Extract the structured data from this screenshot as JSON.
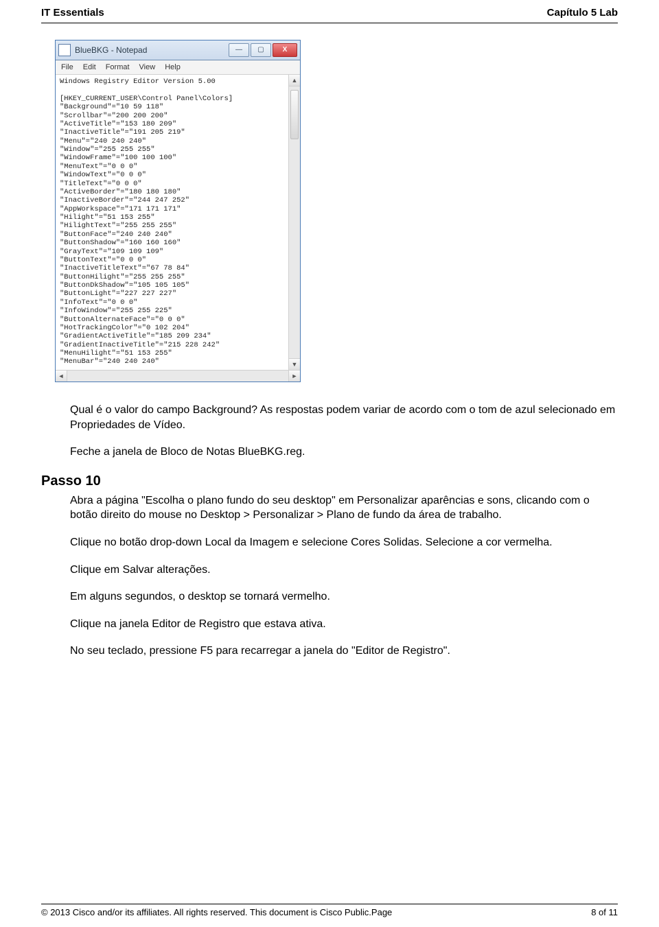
{
  "header": {
    "left": "IT Essentials",
    "right": "Capítulo 5 Lab"
  },
  "notepad": {
    "title": "BlueBKG - Notepad",
    "menu": [
      "File",
      "Edit",
      "Format",
      "View",
      "Help"
    ],
    "content": "Windows Registry Editor Version 5.00\n\n[HKEY_CURRENT_USER\\Control Panel\\Colors]\n\"Background\"=\"10 59 118\"\n\"Scrollbar\"=\"200 200 200\"\n\"ActiveTitle\"=\"153 180 209\"\n\"InactiveTitle\"=\"191 205 219\"\n\"Menu\"=\"240 240 240\"\n\"Window\"=\"255 255 255\"\n\"WindowFrame\"=\"100 100 100\"\n\"MenuText\"=\"0 0 0\"\n\"WindowText\"=\"0 0 0\"\n\"TitleText\"=\"0 0 0\"\n\"ActiveBorder\"=\"180 180 180\"\n\"InactiveBorder\"=\"244 247 252\"\n\"AppWorkspace\"=\"171 171 171\"\n\"Hilight\"=\"51 153 255\"\n\"HilightText\"=\"255 255 255\"\n\"ButtonFace\"=\"240 240 240\"\n\"ButtonShadow\"=\"160 160 160\"\n\"GrayText\"=\"109 109 109\"\n\"ButtonText\"=\"0 0 0\"\n\"InactiveTitleText\"=\"67 78 84\"\n\"ButtonHilight\"=\"255 255 255\"\n\"ButtonDkShadow\"=\"105 105 105\"\n\"ButtonLight\"=\"227 227 227\"\n\"InfoText\"=\"0 0 0\"\n\"InfoWindow\"=\"255 255 225\"\n\"ButtonAlternateFace\"=\"0 0 0\"\n\"HotTrackingColor\"=\"0 102 204\"\n\"GradientActiveTitle\"=\"185 209 234\"\n\"GradientInactiveTitle\"=\"215 228 242\"\n\"MenuHilight\"=\"51 153 255\"\n\"MenuBar\"=\"240 240 240\""
  },
  "body": {
    "p1": "Qual é o valor do campo Background? As respostas podem variar de acordo com o tom de azul selecionado em Propriedades de Vídeo.",
    "p2": "Feche a janela de Bloco de Notas BlueBKG.reg.",
    "step_label": "Passo 10",
    "p3": "Abra a página \"Escolha o plano fundo do seu desktop\" em Personalizar aparências e sons, clicando com o botão direito do mouse no Desktop > Personalizar > Plano de fundo da área de trabalho.",
    "p4": "Clique no botão drop-down Local da Imagem e selecione Cores Solidas. Selecione a cor vermelha.",
    "p5": "Clique em Salvar alterações.",
    "p6": "Em alguns segundos, o desktop se tornará vermelho.",
    "p7": "Clique na janela Editor de Registro que estava ativa.",
    "p8": "No seu teclado, pressione F5 para recarregar a janela do \"Editor de Registro\"."
  },
  "footer": {
    "left": "© 2013 Cisco and/or its affiliates. All rights reserved. This document is Cisco Public.Page",
    "right": "8 of 11"
  }
}
